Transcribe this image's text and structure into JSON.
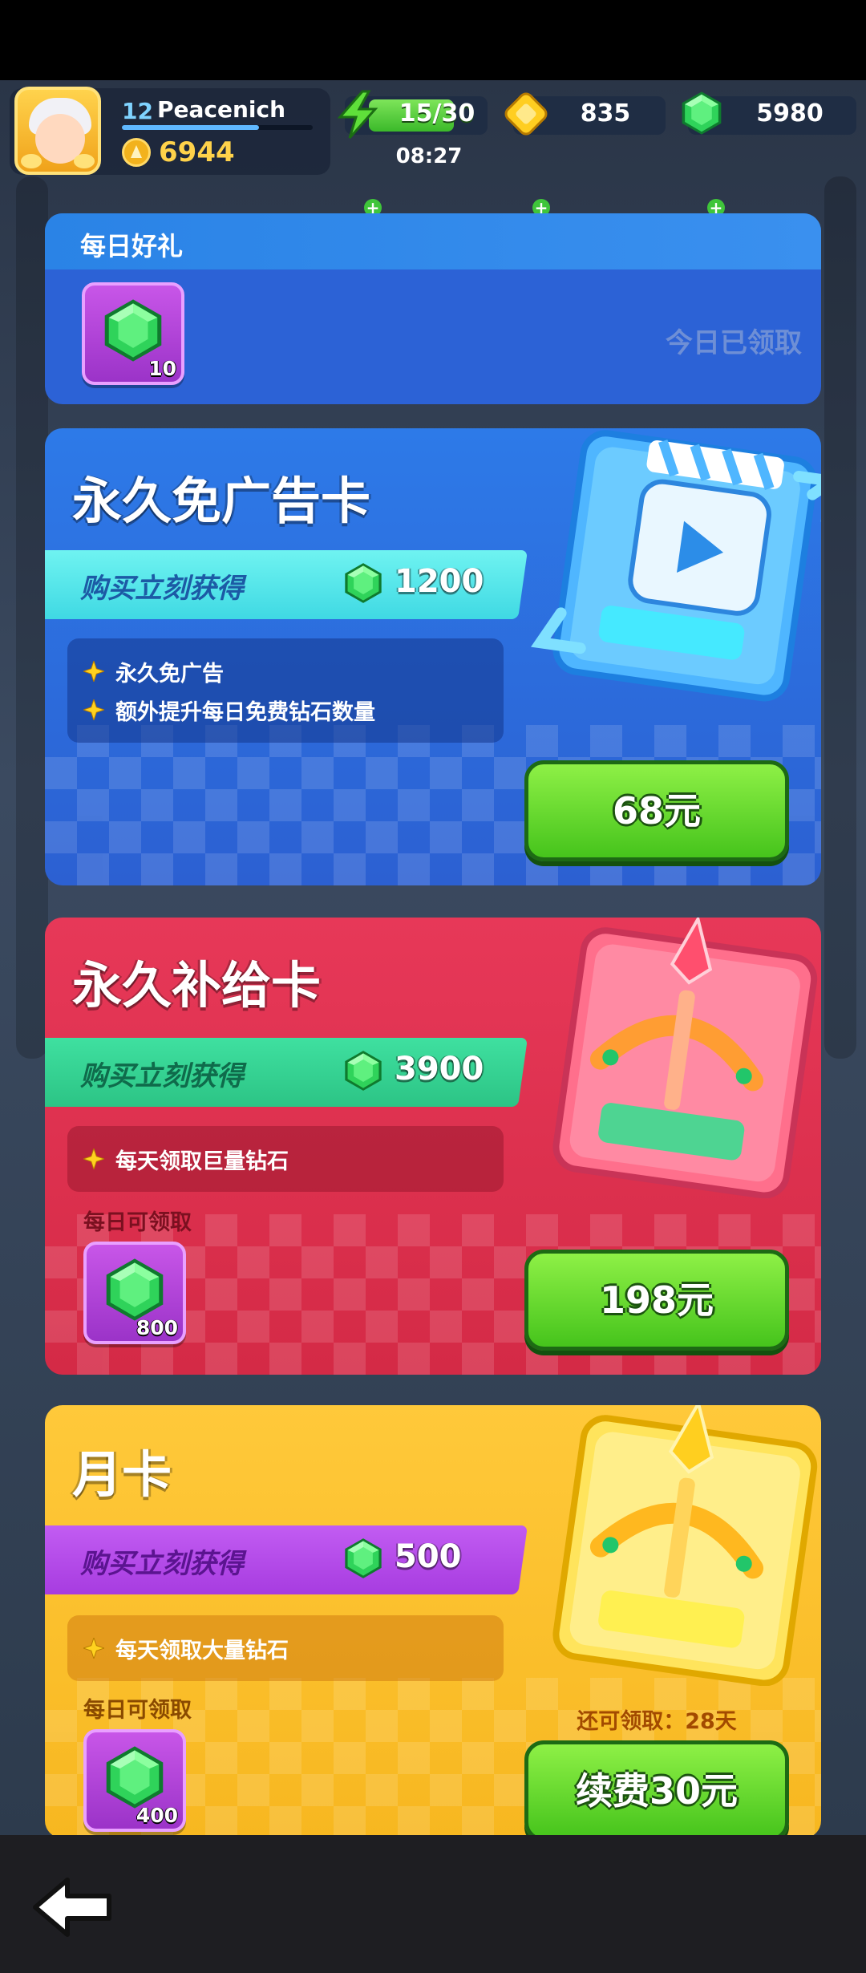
{
  "hud": {
    "player_level": "12",
    "player_name": "Peacenich",
    "trophies": "6944",
    "energy": "15/30",
    "energy_timer": "08:27",
    "gold": "835",
    "gems": "5980"
  },
  "daily_gift": {
    "title": "每日好礼",
    "gem_qty": "10",
    "status": "今日已领取"
  },
  "cards": [
    {
      "title": "永久免广告卡",
      "ribbon_text": "购买立刻获得",
      "instant_gems": "1200",
      "features": [
        "永久免广告",
        "额外提升每日免费钻石数量"
      ],
      "price": "68元",
      "art_icon": "play-video-icon"
    },
    {
      "title": "永久补给卡",
      "ribbon_text": "购买立刻获得",
      "instant_gems": "3900",
      "features": [
        "每天领取巨量钻石"
      ],
      "daily_label": "每日可领取",
      "daily_gems": "800",
      "price": "198元",
      "art_icon": "crossbow-icon"
    },
    {
      "title": "月卡",
      "ribbon_text": "购买立刻获得",
      "instant_gems": "500",
      "features": [
        "每天领取大量钻石"
      ],
      "daily_label": "每日可领取",
      "daily_gems": "400",
      "remaining": "还可领取：28天",
      "price": "续费30元",
      "art_icon": "crossbow-icon"
    }
  ],
  "colors": {
    "blue_card": "#2c6be0",
    "red_card": "#dc3050",
    "yellow_card": "#fbc02d",
    "buy_button": "#5cd424",
    "gem": "#2fd35a"
  },
  "nav": {
    "back_icon": "back-arrow-icon"
  }
}
